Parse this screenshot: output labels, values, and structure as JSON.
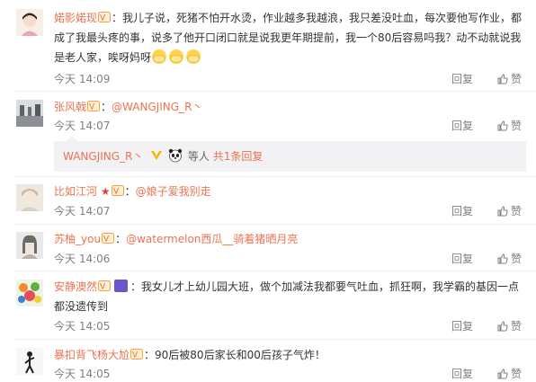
{
  "comments": [
    {
      "username": "婼影婼现",
      "sep": "：",
      "text": "我儿子说，死猪不怕开水烫，作业越多我越浪，我只差没吐血，每次要他写作业，都成了我最头疼的事，说多了他开口闭口就是说我更年期提前，我一个80后容易吗我？动不动就说我是老人家，唉呀妈呀",
      "time": "今天 14:09",
      "reply": "回复",
      "like": "赞"
    },
    {
      "username": "张风戟",
      "sep": "：",
      "at": "@WANGJING_R丶",
      "time": "今天 14:07",
      "reply": "回复",
      "like": "赞",
      "sub": {
        "name": "WANGJING_R丶",
        "others": "等人",
        "total": "共1条回复"
      }
    },
    {
      "username": "比如江河",
      "sep": "：",
      "at": "@娘子爱我别走",
      "time": "今天 14:07",
      "reply": "回复",
      "like": "赞"
    },
    {
      "username": "苏柚_you",
      "sep": "：",
      "at": "@watermelon西瓜__骑着猪晒月亮",
      "time": "今天 14:06",
      "reply": "回复",
      "like": "赞"
    },
    {
      "username": "安静澳然",
      "sep": "：",
      "text": "我女儿才上幼儿园大班，做个加减法我都要气吐血，抓狂啊，我学霸的基因一点都没遗传到",
      "time": "今天 14:05",
      "reply": "回复",
      "like": "赞"
    },
    {
      "username": "暴扣背飞杨大尬",
      "sep": "：",
      "text": "90后被80后家长和00后孩子气炸！",
      "time": "今天 14:05",
      "reply": "回复",
      "like": "赞"
    }
  ],
  "colors": {
    "link": "#eb7350",
    "meta": "#808080",
    "subbox": "#f2f2f5"
  }
}
